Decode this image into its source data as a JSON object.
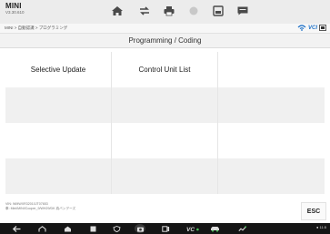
{
  "header": {
    "brand": "MINI",
    "version": "V3.30.610",
    "toolbar_icons": [
      "home-icon",
      "vehicle-swap-icon",
      "print-icon",
      "help-icon",
      "save-icon",
      "chat-icon"
    ]
  },
  "breadcrumb": "MINI > 自動認識 > プログラミング",
  "vci": {
    "label": "VCI",
    "status_color": "#1b6fc7"
  },
  "page_title": "Programming / Coding",
  "grid": {
    "rows": [
      [
        "Selective Update",
        "Control Unit List",
        ""
      ],
      [
        "",
        "",
        ""
      ],
      [
        "",
        "",
        ""
      ],
      [
        "",
        "",
        ""
      ]
    ],
    "row_colors": [
      "#ffffff",
      "#f0f0f0",
      "#ffffff",
      "#f0f0f0"
    ]
  },
  "footer": {
    "vin_line": "VIN: WMWXR32010JT07653",
    "path_line": "車: Mini/MINI/Cooper_9/WH29/DK 真バンデーズ",
    "esc_label": "ESC"
  },
  "system_bar": {
    "icons": [
      "back-icon",
      "house-icon",
      "home-outline-icon",
      "square-icon",
      "shield-icon",
      "camera-icon",
      "scan-icon",
      "vci-icon",
      "car-icon",
      "recorder-icon"
    ],
    "status": "● 11:5"
  }
}
